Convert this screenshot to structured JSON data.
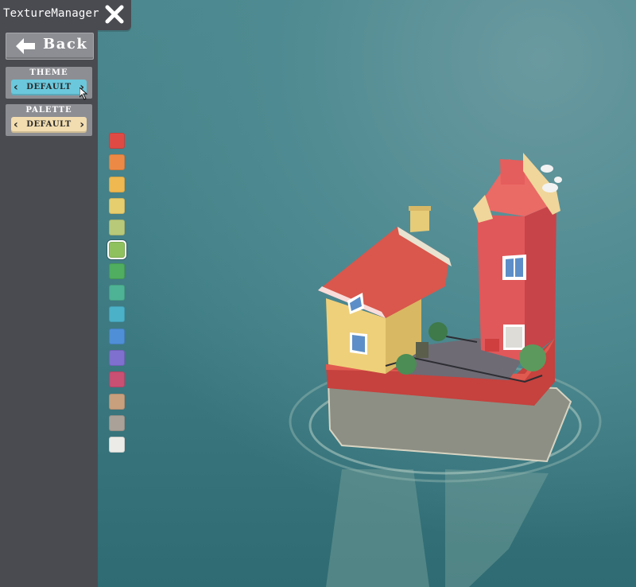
{
  "window": {
    "title": "TextureManager"
  },
  "back_button": {
    "label": "Back"
  },
  "theme": {
    "label": "THEME",
    "value": "DEFAULT",
    "color": "#6bc8dc"
  },
  "palette": {
    "label": "PALETTE",
    "value": "DEFAULT",
    "color": "#f2ddb0"
  },
  "swatches": [
    {
      "color": "#e04a45"
    },
    {
      "color": "#ec8a45"
    },
    {
      "color": "#efb850"
    },
    {
      "color": "#e6cd6e"
    },
    {
      "color": "#b9c97a"
    },
    {
      "color": "#8fc15f",
      "selected": true
    },
    {
      "color": "#4fae5f"
    },
    {
      "color": "#4eb295"
    },
    {
      "color": "#4bb1c8"
    },
    {
      "color": "#4f8fd8"
    },
    {
      "color": "#7f6fcf"
    },
    {
      "color": "#c94f73"
    },
    {
      "color": "#c8a07e"
    },
    {
      "color": "#aaa198"
    },
    {
      "color": "#ecebe7"
    }
  ],
  "icons": [
    "close-icon",
    "left-arrow-icon",
    "chevron-left-icon",
    "chevron-right-icon",
    "mouse-cursor-icon"
  ]
}
